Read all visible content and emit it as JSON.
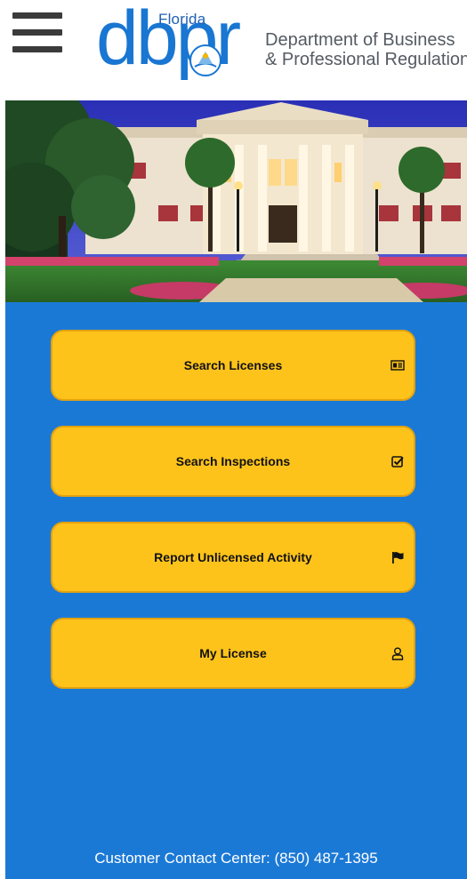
{
  "header": {
    "menu_icon": "hamburger-menu-icon",
    "logo": {
      "state": "Florida",
      "wordmark": "dbpr",
      "department_line1": "Department of Business",
      "department_line2": "& Professional Regulation"
    }
  },
  "hero": {
    "image": "florida-historic-capitol-photo"
  },
  "menu": {
    "items": [
      {
        "label": "Search Licenses",
        "icon": "id-card-icon"
      },
      {
        "label": "Search Inspections",
        "icon": "checkbox-icon"
      },
      {
        "label": "Report Unlicensed Activity",
        "icon": "flag-icon"
      },
      {
        "label": "My License",
        "icon": "user-icon"
      }
    ]
  },
  "footer": {
    "contact": "Customer Contact Center: (850) 487-1395"
  },
  "colors": {
    "background_blue": "#1b79d6",
    "button_yellow": "#fdc31b",
    "button_border": "#e3a20f",
    "logo_blue": "#1976d2",
    "logo_gray": "#555b63"
  }
}
